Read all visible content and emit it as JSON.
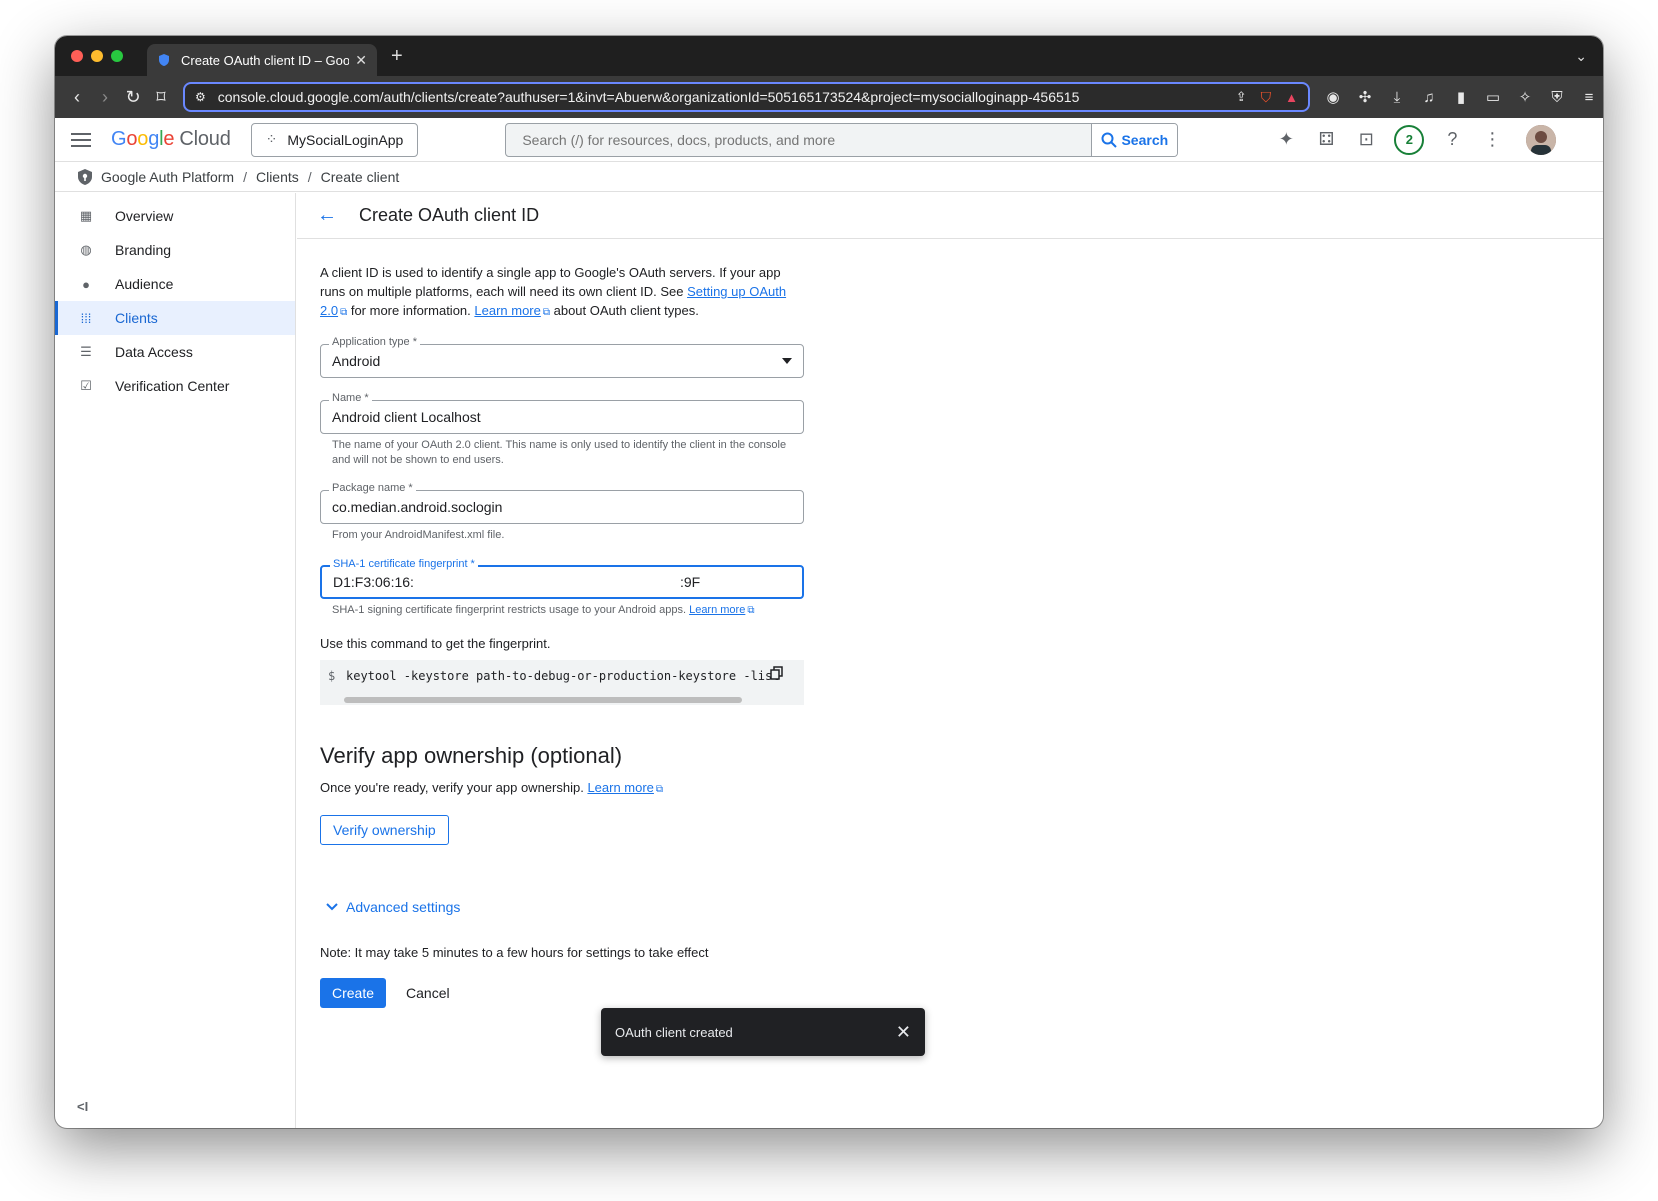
{
  "browser": {
    "tab_title": "Create OAuth client ID – Goo",
    "tab_close": "✕",
    "new_tab": "+",
    "url": "console.cloud.google.com/auth/clients/create?authuser=1&invt=Abuerw&organizationId=505165173524&project=mysocialloginapp-456515"
  },
  "header": {
    "logo_google": [
      "G",
      "o",
      "o",
      "g",
      "l",
      "e"
    ],
    "logo_cloud": "Cloud",
    "project_name": "MySocialLoginApp",
    "search_placeholder": "Search (/) for resources, docs, products, and more",
    "search_button": "Search",
    "notifications_count": "2"
  },
  "breadcrumb": {
    "items": [
      "Google Auth Platform",
      "Clients",
      "Create client"
    ],
    "separator": "/"
  },
  "sidebar": {
    "items": [
      {
        "label": "Overview",
        "icon": "dashboard-icon"
      },
      {
        "label": "Branding",
        "icon": "palette-icon"
      },
      {
        "label": "Audience",
        "icon": "person-icon"
      },
      {
        "label": "Clients",
        "icon": "grid-icon",
        "active": true
      },
      {
        "label": "Data Access",
        "icon": "data-access-icon"
      },
      {
        "label": "Verification Center",
        "icon": "checkbox-icon"
      }
    ],
    "collapse_label": "<I"
  },
  "main": {
    "title": "Create OAuth client ID",
    "intro": {
      "part1": "A client ID is used to identify a single app to Google's OAuth servers. If your app runs on multiple platforms, each will need its own client ID. See ",
      "link1": "Setting up OAuth 2.0",
      "part2": " for more information. ",
      "link2": "Learn more",
      "part3": " about OAuth client types."
    },
    "application_type": {
      "label": "Application type *",
      "value": "Android"
    },
    "name": {
      "label": "Name *",
      "value": "Android client Localhost",
      "helper": "The name of your OAuth 2.0 client. This name is only used to identify the client in the console and will not be shown to end users."
    },
    "package_name": {
      "label": "Package name *",
      "value": "co.median.android.soclogin",
      "helper": "From your AndroidManifest.xml file."
    },
    "sha1": {
      "label": "SHA-1 certificate fingerprint *",
      "value_start": "D1:F3:06:16:",
      "value_end": ":9F",
      "helper": "SHA-1 signing certificate fingerprint restricts usage to your Android apps. ",
      "helper_link": "Learn more"
    },
    "command_label": "Use this command to get the fingerprint.",
    "command_prompt": "$",
    "command": "keytool -keystore path-to-debug-or-production-keystore -list",
    "verify": {
      "title": "Verify app ownership (optional)",
      "desc": "Once you're ready, verify your app ownership. ",
      "desc_link": "Learn more",
      "button": "Verify ownership"
    },
    "advanced_settings": "Advanced settings",
    "note": "Note: It may take 5 minutes to a few hours for settings to take effect",
    "create_button": "Create",
    "cancel_button": "Cancel"
  },
  "snackbar": {
    "message": "OAuth client created"
  },
  "colors": {
    "accent": "#1a73e8",
    "active_bg": "#e8f0fe",
    "snackbar_bg": "#202124"
  }
}
